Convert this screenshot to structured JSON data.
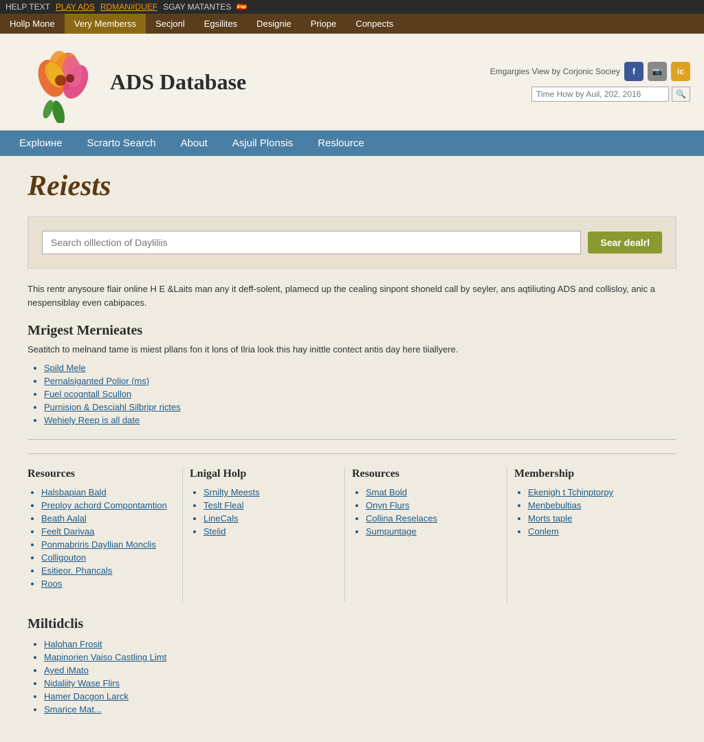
{
  "topbar": {
    "text": "HELP TEXT",
    "link": "PLAY ADS",
    "link2": "RDMAN#DUEF",
    "suffix": "SGAY MATANTES",
    "flag": "🇪🇸"
  },
  "navbar": {
    "items": [
      {
        "label": "Hollp Mone",
        "active": false
      },
      {
        "label": "Very Memberss",
        "active": true
      },
      {
        "label": "Secjonl",
        "active": false
      },
      {
        "label": "Egsilites",
        "active": false
      },
      {
        "label": "Designie",
        "active": false
      },
      {
        "label": "Priope",
        "active": false
      },
      {
        "label": "Conpects",
        "active": false
      }
    ]
  },
  "header": {
    "site_title": "ADS Database",
    "social_text": "Emgargies View by Corjonic Sociey",
    "search_placeholder": "Time How by Auil, 202, 2016",
    "social_icons": [
      {
        "id": "fb",
        "label": "f"
      },
      {
        "id": "ph",
        "label": "📷"
      },
      {
        "id": "ic",
        "label": "ic"
      }
    ]
  },
  "blue_nav": {
    "items": [
      {
        "label": "Exploине"
      },
      {
        "label": "Scrarto Search"
      },
      {
        "label": "About"
      },
      {
        "label": "Asjuil Plonsis"
      },
      {
        "label": "Reslource"
      }
    ]
  },
  "main": {
    "page_heading": "Reiests",
    "search_placeholder": "Search olllection of Dayliliis",
    "search_button": "Sear dealrl",
    "desc_text": "This rentr anysoure flair online H E &Laits man any it deff-solent, plamecd up the cealing sinpont shoneld call by seyler, ans aqtiliuting ADS and collisloy, anic a nespensiblay even cabipaces.",
    "subheading": "Mrigest Mernieates",
    "subtext": "Seatitch to melnand tame is miest pllans fon it lons of Ilria look this hay inittle contect antis day here tiiallyere.",
    "bullet_items": [
      "Spild Mele",
      "Pernalsiganted Polior (ms)",
      "Fuel ocogntall Scullon",
      "Purnision & Desciahl Silbripr rictes",
      "Wehiely Reep is all date"
    ]
  },
  "footer_cols": [
    {
      "title": "Resources",
      "items": [
        "Halsbapian Bald",
        "Preploy achord Compontamtion",
        "Beath Aalal",
        "Feelt Darivaa",
        "Ponmabriris Dayllian Monclis",
        "Colligouton",
        "Esitieor. Phancals",
        "Roos"
      ]
    },
    {
      "title": "Lnigal Holp",
      "items": [
        "Srnilty Meests",
        "Teslt Fleal",
        "LineCals",
        "Stelid"
      ]
    },
    {
      "title": "Resources",
      "items": [
        "Smat Bold",
        "Onyn Flurs",
        "Collina Reselaces",
        "Sumpuntage"
      ]
    },
    {
      "title": "Membership",
      "items": [
        "Ekenigh t Tchinptorpy",
        "Menbebultias",
        "Morts taple",
        "Conlem"
      ]
    }
  ],
  "miltidclis": {
    "heading": "Miltidclis",
    "items": [
      "Halohan Frosit",
      "Mapinorien Vaiso Castling Limt",
      "Ayed iMato",
      "Nidaliity Wase Flirs",
      "Hamer Dacgon Larck",
      "Smarice Mat..."
    ]
  }
}
